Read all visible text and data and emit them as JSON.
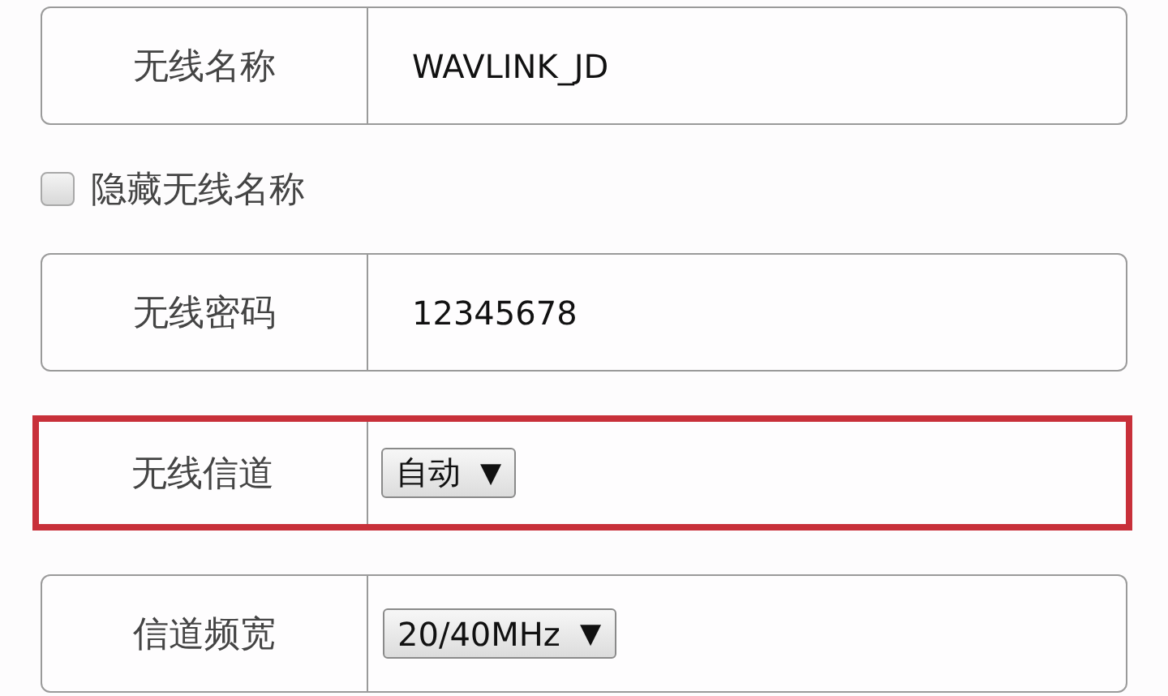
{
  "fields": [
    {
      "kind": "text",
      "label": "无线名称",
      "value": "WAVLINK_JD",
      "highlighted": false
    },
    {
      "kind": "checkbox",
      "label": "隐藏无线名称",
      "checked": false
    },
    {
      "kind": "text",
      "label": "无线密码",
      "value": "12345678",
      "highlighted": false
    },
    {
      "kind": "select",
      "label": "无线信道",
      "value": "自动",
      "arrow": "▼",
      "highlighted": true
    },
    {
      "kind": "select",
      "label": "信道频宽",
      "value": "20/40MHz",
      "arrow": "▼",
      "highlighted": false
    }
  ]
}
